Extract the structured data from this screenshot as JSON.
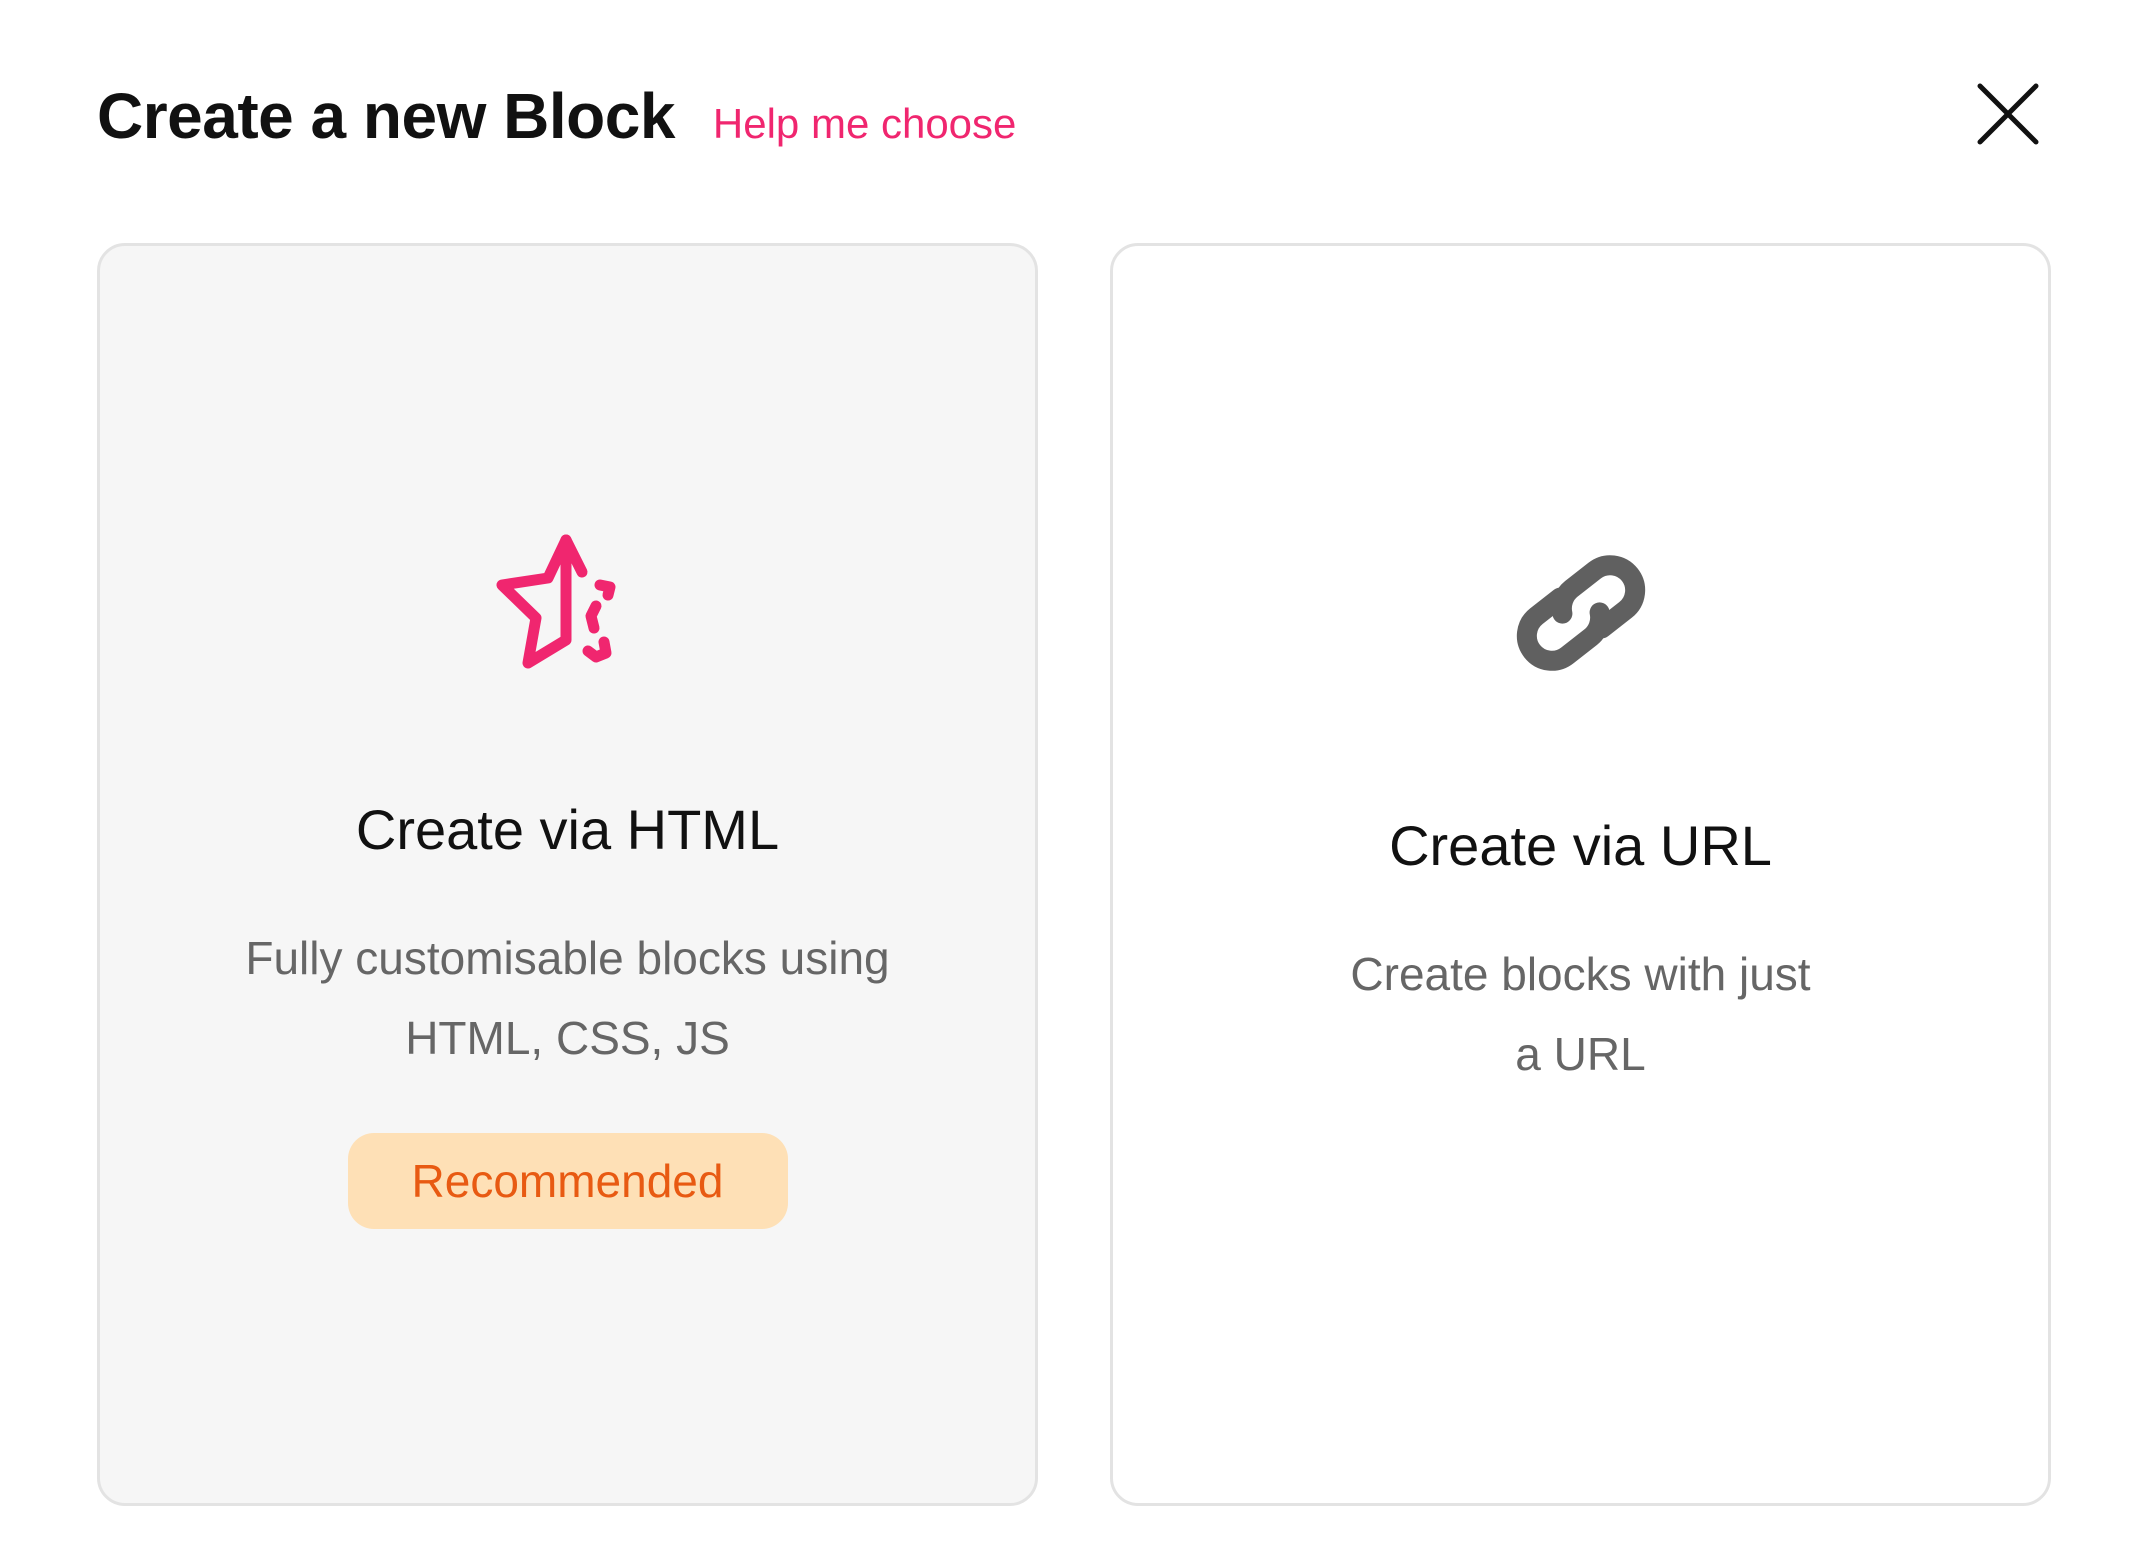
{
  "header": {
    "title": "Create a new Block",
    "help_link": "Help me choose"
  },
  "colors": {
    "accent": "#f0266f",
    "badge_bg": "#fee0b6",
    "badge_text": "#e85a12",
    "card_selected_bg": "#f6f6f6",
    "icon_gray": "#606060"
  },
  "cards": [
    {
      "icon": "sparkle-star-icon",
      "title": "Create via HTML",
      "description_line1": "Fully customisable blocks using",
      "description_line2": "HTML, CSS, JS",
      "badge": "Recommended"
    },
    {
      "icon": "link-icon",
      "title": "Create via URL",
      "description_line1": "Create blocks with just",
      "description_line2": "a URL"
    }
  ]
}
